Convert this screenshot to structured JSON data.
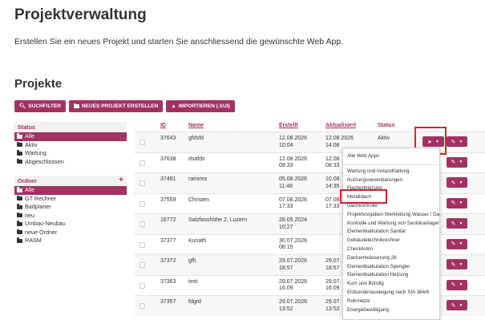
{
  "header": {
    "title": "Projektverwaltung",
    "intro": "Erstellen Sie ein neues Projekt und starten Sie anschliessend die gewünschte Web App.",
    "section": "Projekte"
  },
  "toolbar": {
    "search_label": "SUCHFILTER",
    "new_label": "NEUES PROJEKT ERSTELLEN",
    "import_label": "IMPORTIEREN (.SUI)"
  },
  "sidebar": {
    "status_title": "Status",
    "status_items": [
      "Alle",
      "Aktiv",
      "Wartung",
      "Abgeschlossen"
    ],
    "folder_title": "Ordner",
    "folder_add": "+",
    "folder_items": [
      "Alle",
      "GT Rechner",
      "Badplaner",
      "neu",
      "Umbau-Neubau",
      "neue Ordner",
      "RASM"
    ]
  },
  "table": {
    "headers": {
      "id": "ID",
      "name": "Name",
      "created": "Erstellt",
      "updated": "Aktualisiert",
      "status": "Status"
    },
    "rows": [
      {
        "id": "37643",
        "name": "gfdsfd",
        "created_date": "12.08.2026",
        "created_time": "10:04",
        "updated_date": "12.08.2026",
        "updated_time": "14:08",
        "status": "Aktiv"
      },
      {
        "id": "37638",
        "name": "dsafds",
        "created_date": "12.08.2026",
        "created_time": "08:33",
        "updated_date": "12.08",
        "updated_time": "08:33",
        "status": ""
      },
      {
        "id": "37491",
        "name": "ramirez",
        "created_date": "05.08.2026",
        "created_time": "11:48",
        "updated_date": "10.08.",
        "updated_time": "14:35",
        "status": ""
      },
      {
        "id": "37559",
        "name": "Christen",
        "created_date": "07.08.2026",
        "created_time": "17:33",
        "updated_date": "07.08.",
        "updated_time": "17:33",
        "status": ""
      },
      {
        "id": "16772",
        "name": "Salzfasshöhe 2, Luzern",
        "created_date": "28.05.2024",
        "created_time": "10:27",
        "updated_date": "",
        "updated_time": "",
        "status": ""
      },
      {
        "id": "37377",
        "name": "Kunath",
        "created_date": "30.07.2026",
        "created_time": "08:15",
        "updated_date": "",
        "updated_time": "",
        "status": ""
      },
      {
        "id": "37372",
        "name": "gfh",
        "created_date": "29.07.2026",
        "created_time": "18:57",
        "updated_date": "29.07.",
        "updated_time": "18:57",
        "status": ""
      },
      {
        "id": "37363",
        "name": "test",
        "created_date": "29.07.2026",
        "created_time": "16:09",
        "updated_date": "29.07.",
        "updated_time": "16:09",
        "status": ""
      },
      {
        "id": "37357",
        "name": "fdgrd",
        "created_date": "29.07.2026",
        "created_time": "13:52",
        "updated_date": "29.07.",
        "updated_time": "13:52",
        "status": ""
      }
    ]
  },
  "apps_menu": {
    "items": [
      "Alle Web Apps",
      "Wartung und Instandhaltung",
      "Nutzungsvereinbarungen",
      "Flachenheizung",
      "Metalldach",
      "Dachkontrolle",
      "Projektvorgaben Werkleitung Wasser / Gas",
      "Kontrolle und Wartung von Sanitäranlagen",
      "Elementkalkulation Sanitär",
      "Gebäudetechnikrechner",
      "Checklisten",
      "Dachentwässerung 26",
      "Elementkalkulation Spengler",
      "Elementkalkulation Heizung",
      "Kurz und Bündig",
      "Erdsondenauslegung nach SIA 384/6",
      "Rohrnetze",
      "Energiebewilligung"
    ]
  },
  "colors": {
    "accent": "#a23262",
    "highlight": "#d9232e"
  },
  "icons": {
    "search": "search-icon",
    "folder": "folder-icon",
    "import": "upload-user-icon",
    "rocket": "rocket-icon",
    "edit": "pencil-icon",
    "caret": "caret-down-icon"
  }
}
